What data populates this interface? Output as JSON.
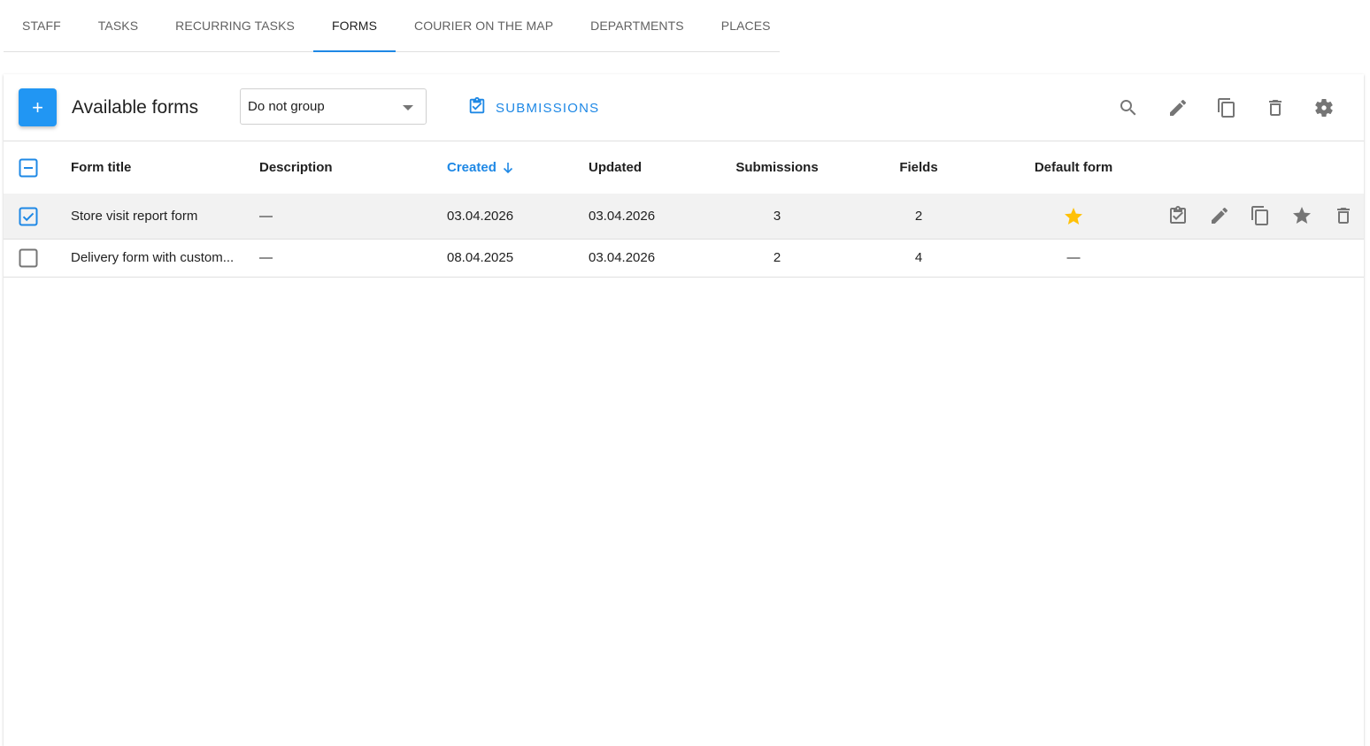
{
  "tabs": [
    {
      "label": "STAFF"
    },
    {
      "label": "TASKS"
    },
    {
      "label": "RECURRING TASKS"
    },
    {
      "label": "FORMS",
      "active": true
    },
    {
      "label": "COURIER ON THE MAP"
    },
    {
      "label": "DEPARTMENTS"
    },
    {
      "label": "PLACES"
    }
  ],
  "toolbar": {
    "add_label": "+",
    "title": "Available forms",
    "group_value": "Do not group",
    "submissions_label": "SUBMISSIONS",
    "icons": [
      "search-icon",
      "pencil-icon",
      "copy-icon",
      "trash-icon",
      "gear-icon"
    ]
  },
  "table": {
    "columns": {
      "title": "Form title",
      "description": "Description",
      "created": "Created",
      "updated": "Updated",
      "submissions": "Submissions",
      "fields": "Fields",
      "default": "Default form"
    },
    "sort_column": "created",
    "sort_direction": "desc",
    "rows": [
      {
        "checked": true,
        "title": "Store visit report form",
        "description": "—",
        "created": "03.04.2026",
        "updated": "03.04.2026",
        "submissions": "3",
        "fields": "2",
        "default": "star",
        "default_text": ""
      },
      {
        "checked": false,
        "title": "Delivery form with custom...",
        "description": "—",
        "created": "08.04.2025",
        "updated": "03.04.2026",
        "submissions": "2",
        "fields": "4",
        "default": "dash",
        "default_text": "—"
      }
    ]
  },
  "colors": {
    "accent": "#1e88e5",
    "star": "#ffc107",
    "icon": "#757575",
    "selected_row": "#f2f2f2"
  }
}
